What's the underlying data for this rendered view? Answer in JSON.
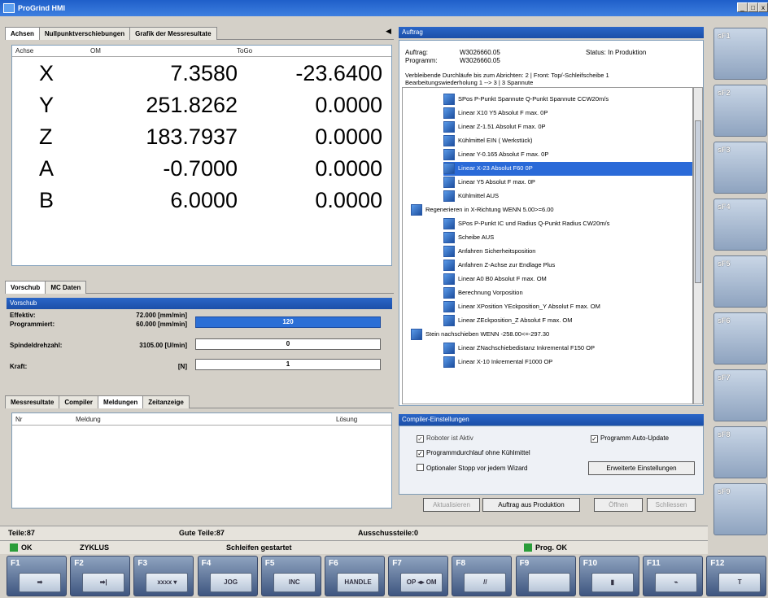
{
  "window": {
    "title": "ProGrind HMI",
    "min": "_",
    "max": "□",
    "close": "x"
  },
  "axes_panel": {
    "tabs": [
      "Achsen",
      "Nullpunktverschiebungen",
      "Grafik der Messresultate"
    ],
    "headers": {
      "axis": "Achse",
      "om": "OM",
      "togo": "ToGo"
    },
    "rows": [
      {
        "axis": "X",
        "om": "7.3580",
        "togo": "-23.6400"
      },
      {
        "axis": "Y",
        "om": "251.8262",
        "togo": "0.0000"
      },
      {
        "axis": "Z",
        "om": "183.7937",
        "togo": "0.0000"
      },
      {
        "axis": "A",
        "om": "-0.7000",
        "togo": "0.0000"
      },
      {
        "axis": "B",
        "om": "6.0000",
        "togo": "0.0000"
      }
    ]
  },
  "feed_panel": {
    "tabs": [
      "Vorschub",
      "MC Daten"
    ],
    "section": "Vorschub",
    "rows": [
      {
        "label": "Effektiv:",
        "value": "72.000 [mm/min]"
      },
      {
        "label": "Programmiert:",
        "value": "60.000 [mm/min]",
        "bar": "120"
      },
      {
        "label": "Spindeldrehzahl:",
        "value": "3105.00 [U/min]",
        "bar": "0"
      },
      {
        "label": "Kraft:",
        "value": "[N]",
        "bar": "1"
      }
    ]
  },
  "msg_panel": {
    "tabs": [
      "Messresultate",
      "Compiler",
      "Meldungen",
      "Zeitanzeige"
    ],
    "headers": {
      "nr": "Nr",
      "meldung": "Meldung",
      "loesung": "Lösung"
    }
  },
  "job": {
    "title": "Auftrag",
    "auftrag_label": "Auftrag:",
    "auftrag": "W3026660.05",
    "programm_label": "Programm:",
    "programm": "W3026660.05",
    "status": "Status: In Produktion",
    "line1": "Verbleibende Durchläufe bis zum Abrichten: 2 | Front: Top/-Schleifscheibe 1",
    "line2": "Bearbeitungswiederholung  1 --> 3 | 3 Spannute",
    "tree": [
      "SPos P-Punkt Spannute Q-Punkt Spannute CCW20m/s",
      "Linear X10 Y5 Absolut F max. 0P",
      "Linear Z-1.51 Absolut F max. 0P",
      "Kühlmittel EIN ( Werkstück)",
      "Linear Y-0.165 Absolut F max. 0P",
      "Linear X-23 Absolut F60 0P",
      "Linear Y5 Absolut F max. 0P",
      "Kühlmittel AUS",
      "Regenerieren in X-Richtung WENN 5.00>=6.00",
      "SPos P-Punkt IC und Radius Q-Punkt Radius CW20m/s",
      "Scheibe AUS",
      "Anfahren Sicherheitsposition",
      "Anfahren Z-Achse zur Endlage Plus",
      "Linear A0 B0 Absolut F max. OM",
      "Berechnung Vorposition",
      "Linear XPosition YEckposition_Y Absolut F max. OM",
      "Linear ZEckposition_Z Absolut F max. OM",
      "Stein nachschieben WENN -258.00<=-297.30",
      "Linear ZNachschiebedistanz Inkremental F150 OP",
      "Linear X-10 Inkremental F1000 OP"
    ]
  },
  "compiler": {
    "title": "Compiler-Einstellungen",
    "robot": "Roboter ist Aktiv",
    "auto_update": "Programm Auto-Update",
    "no_coolant": "Programmdurchlauf ohne Kühlmittel",
    "optional_stop": "Optionaler Stopp vor jedem Wizard",
    "advanced": "Erweiterte Einstellungen"
  },
  "job_buttons": [
    "Aktualisieren",
    "Auftrag aus Produktion",
    "Öffnen",
    "Schliessen"
  ],
  "statusbar": {
    "teile": "Teile:87",
    "gute": "Gute Teile:87",
    "ausschuss": "Ausschussteile:0",
    "ok": "OK",
    "zyklus": "ZYKLUS",
    "schleifen": "Schleifen gestartet",
    "prog": "Prog. OK"
  },
  "sf_buttons": [
    "sF1",
    "sF2",
    "sF3",
    "sF4",
    "sF5",
    "sF6",
    "sF7",
    "sF8",
    "sF9"
  ],
  "f_buttons": [
    {
      "label": "F1",
      "text": "➡"
    },
    {
      "label": "F2",
      "text": "➡|"
    },
    {
      "label": "F3",
      "text": "xxxx ▾"
    },
    {
      "label": "F4",
      "text": "JOG"
    },
    {
      "label": "F5",
      "text": "INC"
    },
    {
      "label": "F6",
      "text": "HANDLE"
    },
    {
      "label": "F7",
      "text": "OP ◂▸ OM"
    },
    {
      "label": "F8",
      "text": "//"
    },
    {
      "label": "F9",
      "text": ""
    },
    {
      "label": "F10",
      "text": "▮"
    },
    {
      "label": "F11",
      "text": "⌁"
    },
    {
      "label": "F12",
      "text": "T"
    }
  ]
}
